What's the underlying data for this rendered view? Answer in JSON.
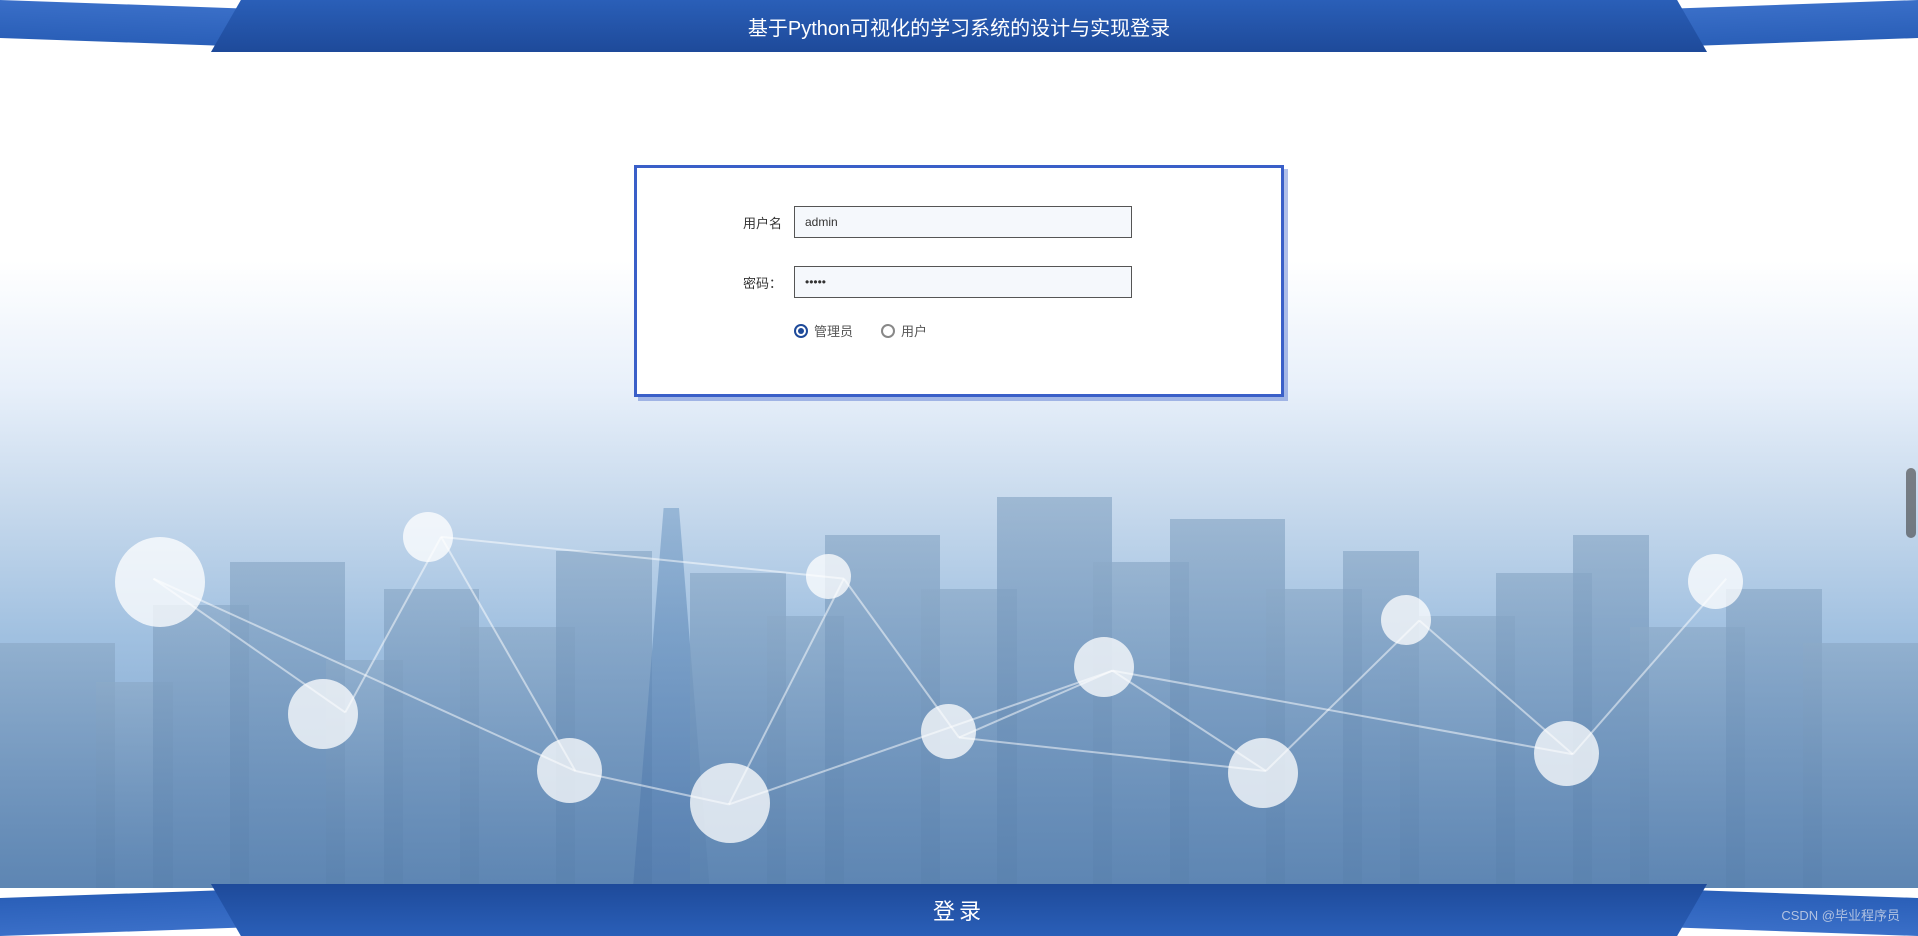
{
  "header": {
    "title": "基于Python可视化的学习系统的设计与实现登录"
  },
  "login": {
    "username_label": "用户名",
    "username_value": "admin",
    "password_label": "密码：",
    "password_value": "•••••",
    "role_admin_label": "管理员",
    "role_user_label": "用户",
    "selected_role": "admin"
  },
  "footer": {
    "login_button": "登录"
  },
  "watermark": {
    "text": "CSDN @毕业程序员"
  }
}
